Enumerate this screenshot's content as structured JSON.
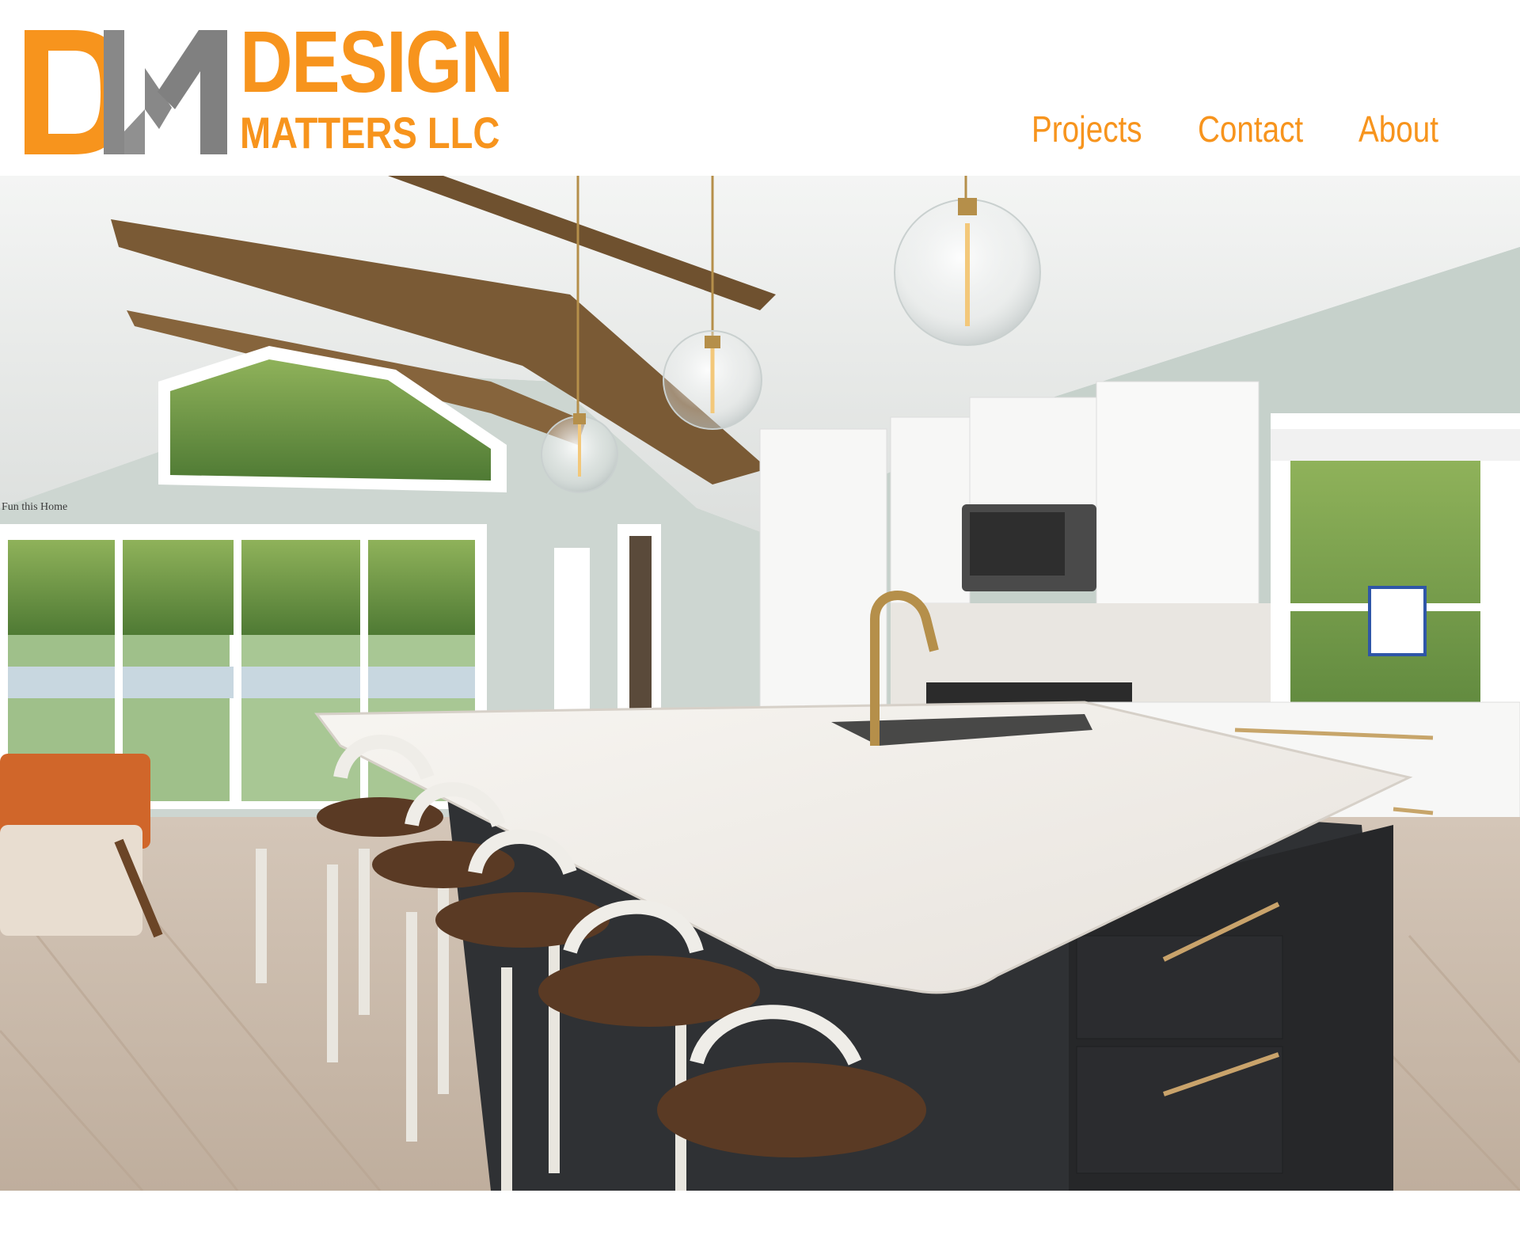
{
  "brand": {
    "logo_mark": "DM",
    "line1": "DESIGN",
    "line2": "MATTERS LLC",
    "colors": {
      "orange": "#F7941D",
      "gray": "#808080"
    }
  },
  "nav": {
    "items": [
      {
        "label": "Projects"
      },
      {
        "label": "Contact"
      },
      {
        "label": "About"
      }
    ]
  },
  "hero": {
    "image_name": "kitchen-photo",
    "wall_sign": "Fun this Home"
  }
}
